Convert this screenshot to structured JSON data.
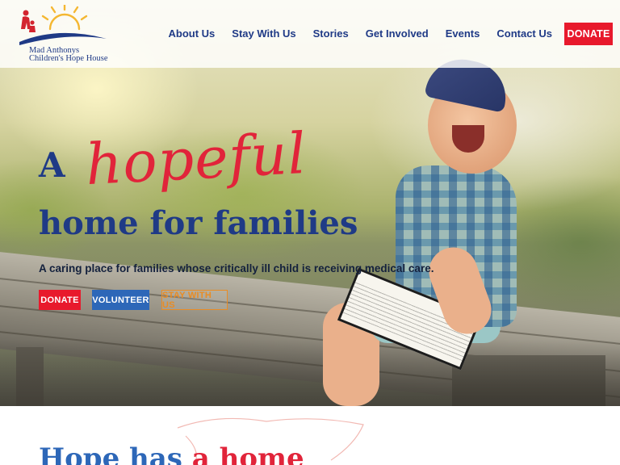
{
  "brand": {
    "name_line1": "Mad Anthonys",
    "name_line2": "Children's Hope House",
    "colors": {
      "navy": "#1f3a86",
      "red": "#e8192c",
      "blue": "#2d67b8",
      "orange": "#e98c24",
      "sun": "#f4b731"
    }
  },
  "nav": {
    "items": [
      {
        "label": "About Us"
      },
      {
        "label": "Stay With Us"
      },
      {
        "label": "Stories"
      },
      {
        "label": "Get Involved"
      },
      {
        "label": "Events"
      },
      {
        "label": "Contact Us"
      }
    ],
    "donate_label": "DONATE"
  },
  "hero": {
    "headline_word": "A",
    "headline_script": "hopeful",
    "headline_line2": "home for families",
    "subtitle": "A caring place for families whose critically ill child is receiving medical care.",
    "buttons": {
      "donate": "DONATE",
      "volunteer": "VOLUNTEER",
      "stay": "STAY WITH US"
    }
  },
  "section2": {
    "title_part1": "Hope has",
    "title_part2": "a home"
  },
  "icons": [
    "sun-logo-icon",
    "family-silhouette-icon",
    "swoosh-icon"
  ]
}
